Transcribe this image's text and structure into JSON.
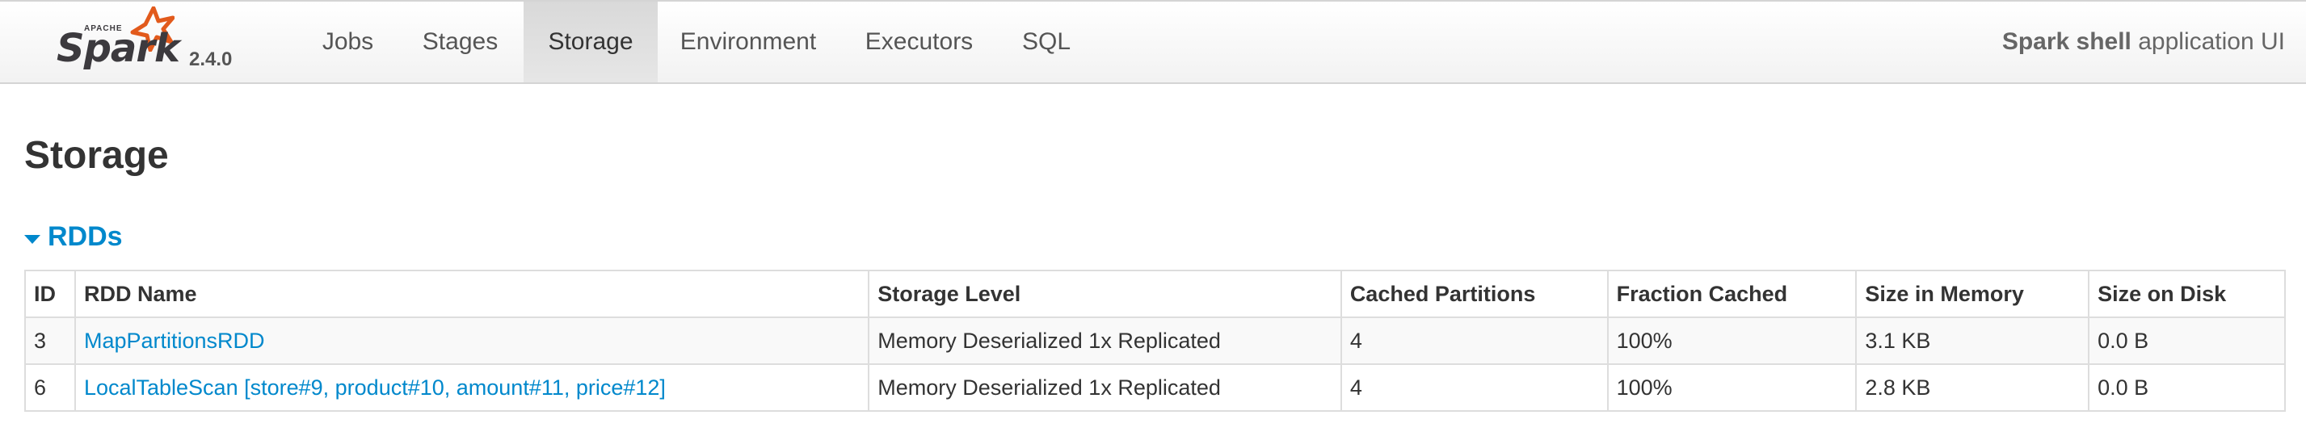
{
  "navbar": {
    "brand_apache": "APACHE",
    "brand_name": "Spark",
    "version": "2.4.0",
    "tabs": [
      {
        "label": "Jobs",
        "active": false
      },
      {
        "label": "Stages",
        "active": false
      },
      {
        "label": "Storage",
        "active": true
      },
      {
        "label": "Environment",
        "active": false
      },
      {
        "label": "Executors",
        "active": false
      },
      {
        "label": "SQL",
        "active": false
      }
    ],
    "app_name": "Spark shell",
    "app_suffix": " application UI"
  },
  "page": {
    "title": "Storage",
    "section": {
      "label": "RDDs",
      "icon": "caret-down-icon"
    }
  },
  "rdd_table": {
    "columns": [
      "ID",
      "RDD Name",
      "Storage Level",
      "Cached Partitions",
      "Fraction Cached",
      "Size in Memory",
      "Size on Disk"
    ],
    "rows": [
      [
        "3",
        "MapPartitionsRDD",
        "Memory Deserialized 1x Replicated",
        "4",
        "100%",
        "3.1 KB",
        "0.0 B"
      ],
      [
        "6",
        "LocalTableScan [store#9, product#10, amount#11, price#12]",
        "Memory Deserialized 1x Replicated",
        "4",
        "100%",
        "2.8 KB",
        "0.0 B"
      ]
    ]
  },
  "colors": {
    "link": "#0088cc",
    "star": "#e25a1c",
    "text": "#333333"
  }
}
